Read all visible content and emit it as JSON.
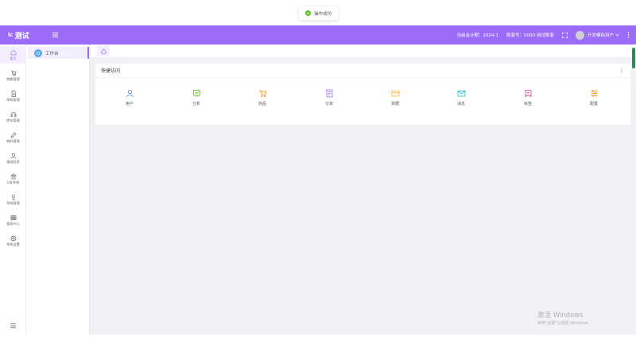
{
  "header": {
    "logo_text": "lc",
    "title": "测试",
    "period_label": "当前会计期：2024-1",
    "account_label": "账套号：0000-测试账套",
    "user_name": "开发模拟用户"
  },
  "toast": {
    "message": "操作成功"
  },
  "rail": {
    "items": [
      {
        "label": "首页",
        "icon": "home-icon"
      },
      {
        "label": "销售管理",
        "icon": "cart-icon"
      },
      {
        "label": "采购管理",
        "icon": "document-icon"
      },
      {
        "label": "库存管理",
        "icon": "headset-icon"
      },
      {
        "label": "物料管理",
        "icon": "pen-icon"
      },
      {
        "label": "基础信息",
        "icon": "user-icon"
      },
      {
        "label": "U友系统",
        "icon": "bank-icon"
      },
      {
        "label": "系统管理",
        "icon": "pin-icon"
      },
      {
        "label": "报表中心",
        "icon": "table-icon"
      },
      {
        "label": "系统设置",
        "icon": "gear-icon"
      }
    ]
  },
  "submenu": {
    "workbench_label": "工作台"
  },
  "quick": {
    "title": "快捷访问",
    "items": [
      {
        "label": "用户",
        "icon": "user-icon",
        "color": "#4a90e2"
      },
      {
        "label": "分析",
        "icon": "chart-icon",
        "color": "#52c41a"
      },
      {
        "label": "商品",
        "icon": "cart-icon",
        "color": "#fa8c16"
      },
      {
        "label": "订单",
        "icon": "order-icon",
        "color": "#9b6cf7"
      },
      {
        "label": "票据",
        "icon": "card-icon",
        "color": "#faad14"
      },
      {
        "label": "消息",
        "icon": "mail-icon",
        "color": "#13c2c2"
      },
      {
        "label": "标签",
        "icon": "tag-icon",
        "color": "#eb2f96"
      },
      {
        "label": "配置",
        "icon": "settings-icon",
        "color": "#fa8c16"
      }
    ]
  },
  "watermark": {
    "line1": "激活 Windows",
    "line2": "转到\"设置\"以激活 Windows。"
  },
  "colors": {
    "brand": "#9b6cf7",
    "background": "#f0f2f5",
    "success": "#52c41a"
  }
}
